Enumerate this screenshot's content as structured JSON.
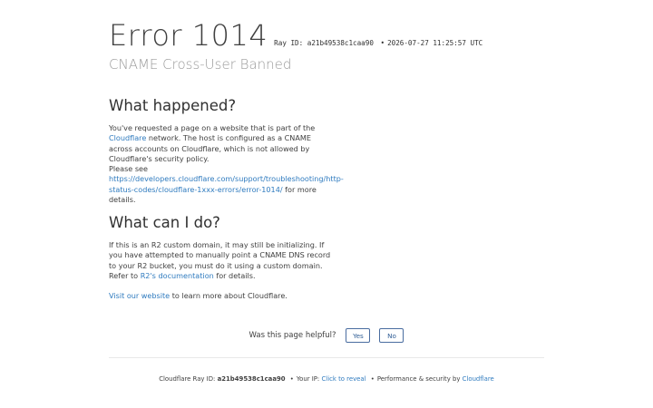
{
  "header": {
    "error_title": "Error 1014",
    "ray_label": "Ray ID: a21b49538c1caa90",
    "sep": "•",
    "timestamp": "2026-07-27 11:25:57 UTC",
    "subtitle": "CNAME Cross-User Banned"
  },
  "what_happened": {
    "heading": "What happened?",
    "text1": "You've requested a page on a website that is part of the",
    "link_cloudflare": "Cloudflare",
    "text2": "network. The host is configured as a CNAME across accounts on Cloudflare, which is not allowed by Cloudflare's security policy.",
    "text3": "Please see",
    "link_docs": "https://developers.cloudflare.com/support/troubleshooting/http-status-codes/cloudflare-1xxx-errors/error-1014/",
    "text4": "for more details."
  },
  "what_can_i_do": {
    "heading": "What can I do?",
    "text1": "If this is an R2 custom domain, it may still be initializing. If you have attempted to manually point a CNAME DNS record to your R2 bucket, you must do it using a custom domain. Refer to",
    "link_r2": "R2's documentation",
    "text2": "for details.",
    "link_visit": "Visit our website",
    "text3": "to learn more about Cloudflare."
  },
  "feedback": {
    "question": "Was this page helpful?",
    "yes_label": "Yes",
    "no_label": "No"
  },
  "footer": {
    "ray_prefix": "Cloudflare Ray ID:",
    "ray_id": "a21b49538c1caa90",
    "sep": "•",
    "ip_prefix": "Your IP:",
    "ip_link": "Click to reveal",
    "perf_prefix": "Performance & security by",
    "perf_link": "Cloudflare"
  }
}
